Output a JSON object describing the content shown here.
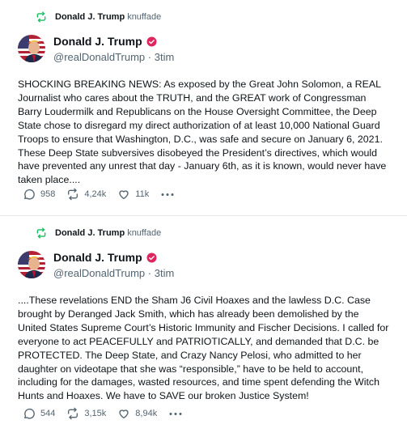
{
  "posts": [
    {
      "retruth": {
        "name": "Donald J. Trump",
        "suffix": "knuffade"
      },
      "author": {
        "name": "Donald J. Trump",
        "handle": "@realDonaldTrump",
        "age": "3tim"
      },
      "text": "SHOCKING BREAKING NEWS: As exposed by the Great John Solomon, a REAL Journalist who cares about the TRUTH, and the GREAT work of Congressman Barry Loudermilk and Republicans on the House Oversight Committee, the Deep State chose to disregard my direct authorization of at least 10,000 National Guard Troops to ensure that Washington, D.C., was safe and secure on January 6, 2021. These Deep State subversives disobeyed the President’s directives, which would have prevented any unrest that day - January 6th, as it is known, would never have taken place....",
      "stats": {
        "replies": "958",
        "retruths": "4,24k",
        "likes": "11k"
      }
    },
    {
      "retruth": {
        "name": "Donald J. Trump",
        "suffix": "knuffade"
      },
      "author": {
        "name": "Donald J. Trump",
        "handle": "@realDonaldTrump",
        "age": "3tim"
      },
      "text": "....These revelations END the Sham J6 Civil Hoaxes and the lawless D.C. Case brought by Deranged Jack Smith, which has already been demolished by the United States Supreme Court’s Historic Immunity and Fischer Decisions. I called for everyone to act PEACEFULLY and PATRIOTICALLY, and demanded that D.C. be PROTECTED. The Deep State, and Crazy Nancy Pelosi, who admitted to her daughter on videotape that she was “responsible,” have to be held to account, including for the damages, wasted resources, and time spent defending the Witch Hunts and Hoaxes. We have to SAVE our broken Justice System!",
      "stats": {
        "replies": "544",
        "retruths": "3,15k",
        "likes": "8,94k"
      }
    }
  ],
  "colors": {
    "retruth_green": "#17bf63",
    "verified_red": "#e0245e",
    "muted": "#536471"
  },
  "icons": {
    "retruth": "retruth-icon",
    "reply": "reply-icon",
    "repost": "repost-icon",
    "like": "heart-icon",
    "more": "more-icon",
    "verified": "verified-badge-icon"
  }
}
